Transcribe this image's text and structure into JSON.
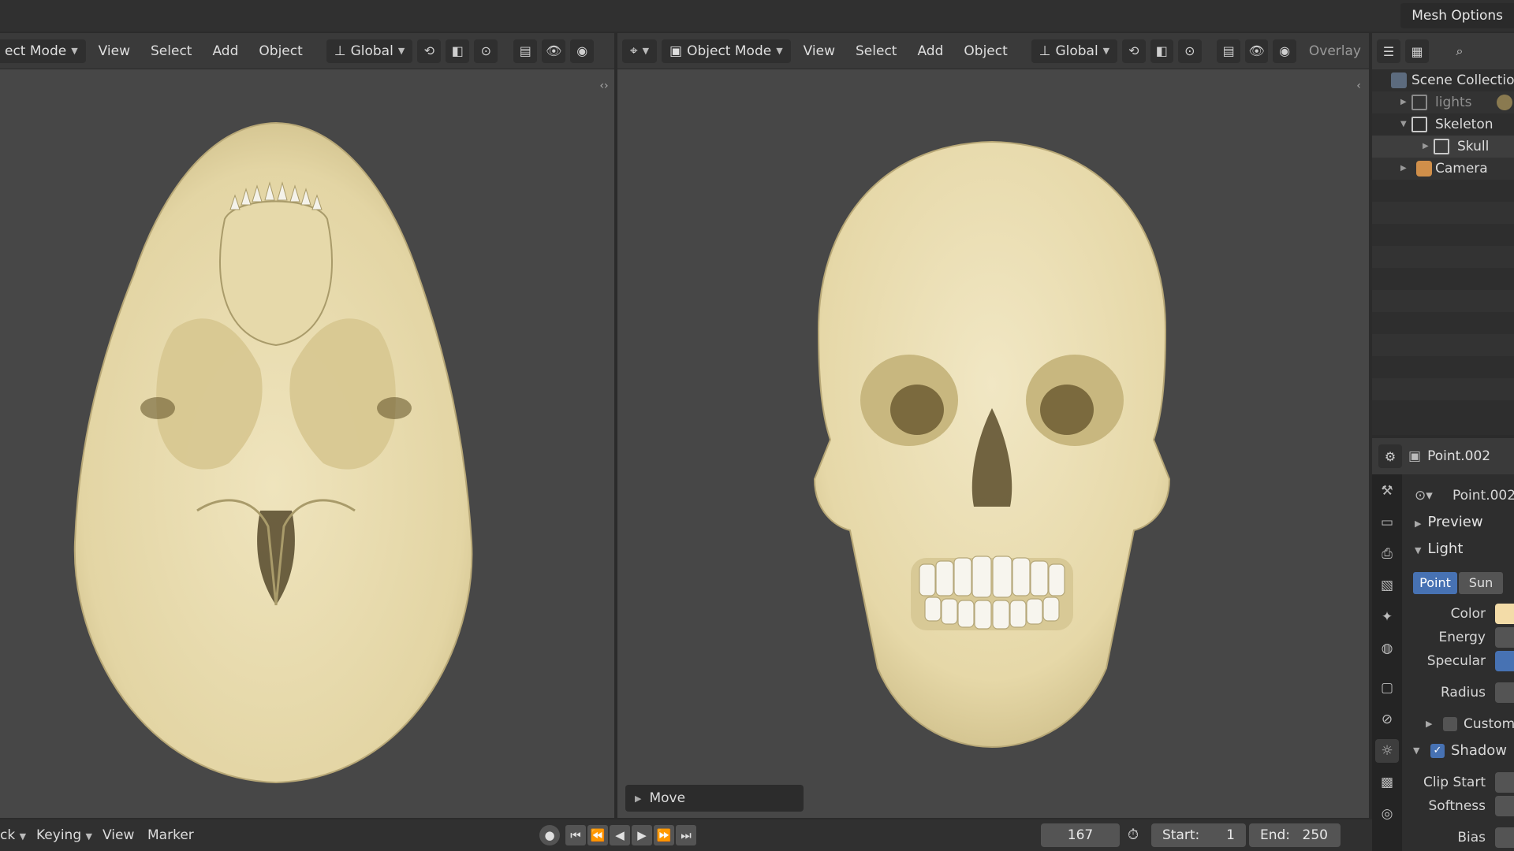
{
  "topbar": {
    "mesh_options": "Mesh Options"
  },
  "left_viewport": {
    "mode": "ect Mode",
    "menus": [
      "View",
      "Select",
      "Add",
      "Object"
    ],
    "orientation": "Global"
  },
  "right_viewport": {
    "mode": "Object Mode",
    "menus": [
      "View",
      "Select",
      "Add",
      "Object"
    ],
    "orientation": "Global",
    "overlay": "Overlay",
    "operator_panel": "Move"
  },
  "outliner": {
    "items": [
      {
        "label": "Scene Collection"
      },
      {
        "label": "lights"
      },
      {
        "label": "Skeleton"
      },
      {
        "label": "Skull"
      },
      {
        "label": "Camera"
      }
    ]
  },
  "properties": {
    "header_object": "Point.002",
    "data_name": "Point.002",
    "preview_label": "Preview",
    "light_label": "Light",
    "light_types": [
      "Point",
      "Sun"
    ],
    "active_light_type": "Point",
    "fields": {
      "color": "Color",
      "energy": "Energy",
      "specular": "Specular",
      "radius": "Radius",
      "custom": "Custom I",
      "shadow": "Shadow",
      "clip_start": "Clip Start",
      "softness": "Softness",
      "bias": "Bias"
    },
    "color_swatch": "#f3dca8",
    "specular_color": "#4772b3"
  },
  "timeline": {
    "left_cut": "ck",
    "keying": "Keying",
    "view": "View",
    "marker": "Marker",
    "current_frame": "167",
    "start_label": "Start:",
    "start_value": "1",
    "end_label": "End:",
    "end_value": "250"
  },
  "colors": {
    "accent": "#4772b3",
    "bone": "#ece0b4",
    "viewport_bg": "#474747"
  }
}
